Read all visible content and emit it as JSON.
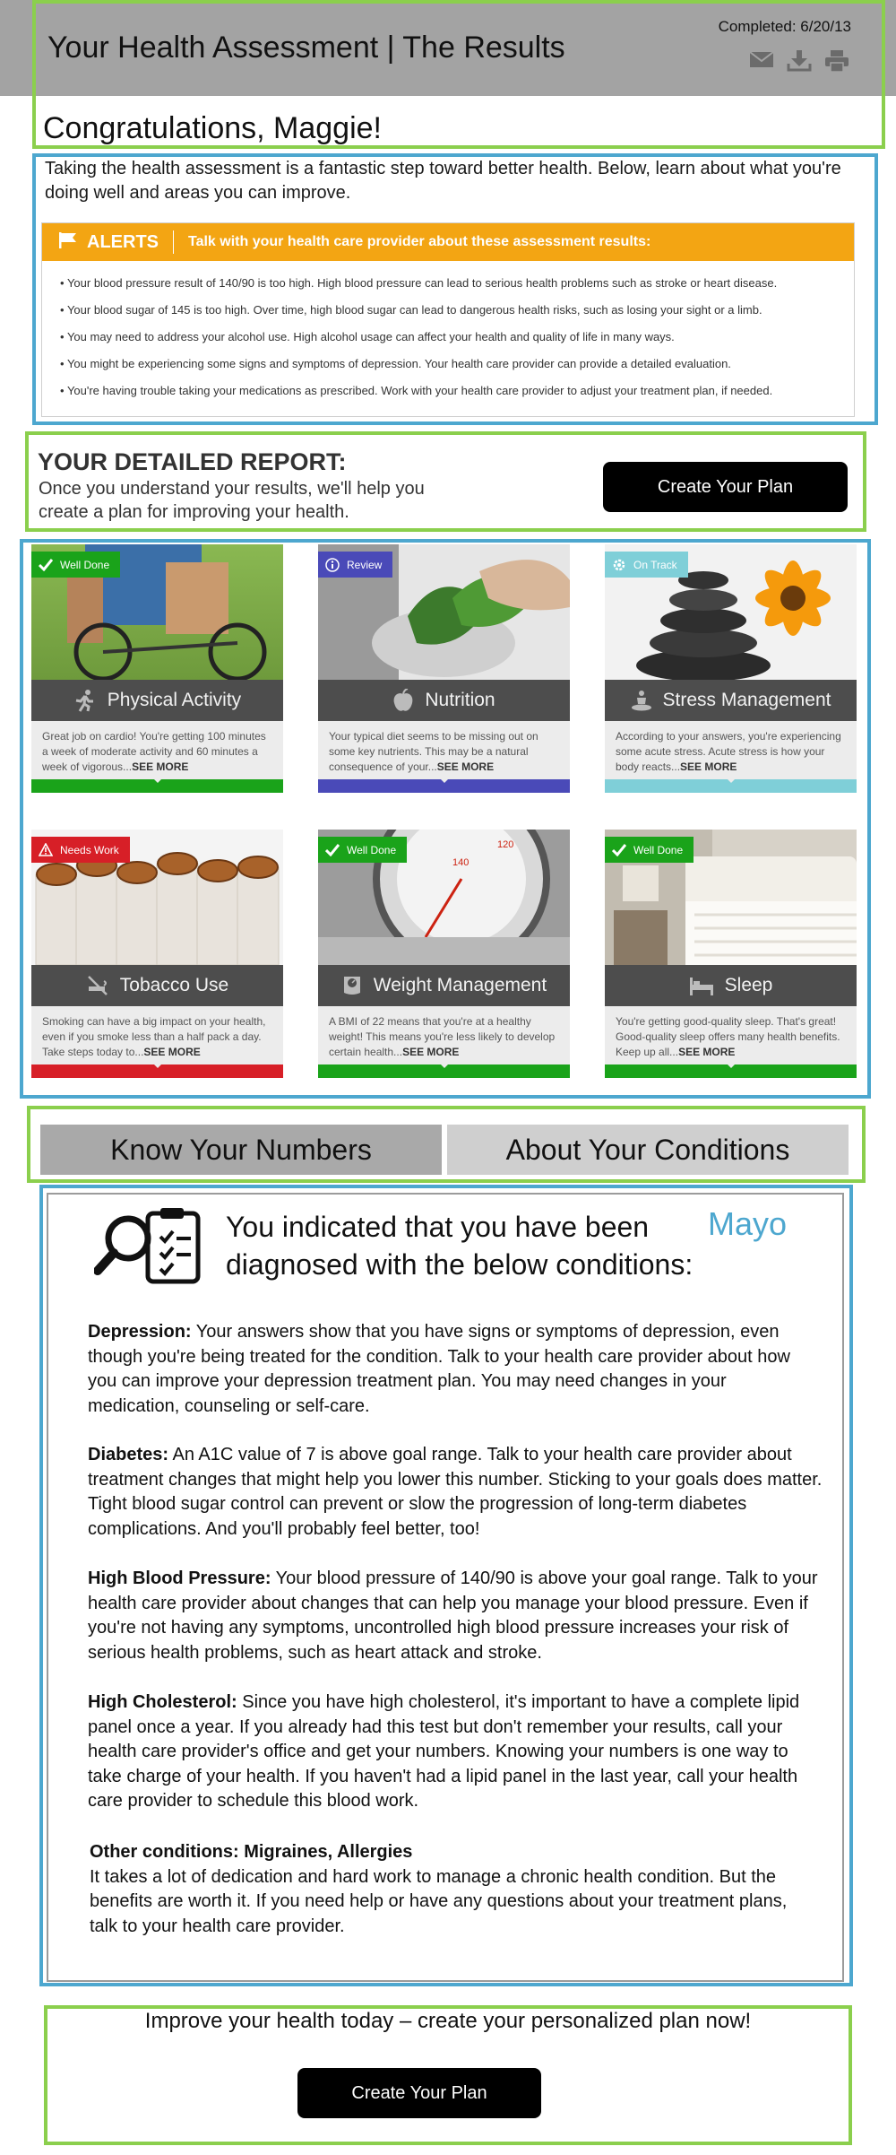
{
  "header": {
    "completed": "Completed: 6/20/13",
    "title": "Your Health Assessment | The Results",
    "icons": [
      "mail-icon",
      "download-icon",
      "print-icon"
    ]
  },
  "greeting": "Congratulations, Maggie!",
  "intro": "Taking the health assessment is a fantastic step toward better health. Below, learn about what you're doing well and areas you can improve.",
  "alerts": {
    "title": "ALERTS",
    "subtitle": "Talk with your health care provider about these assessment results:",
    "items": [
      "Your blood pressure result of 140/90 is too high. High blood pressure can lead to serious health problems such as stroke or heart disease.",
      "Your blood sugar of 145 is too high. Over time, high blood sugar can lead to dangerous health risks, such as losing your sight or a limb.",
      "You may need to address your alcohol use. High alcohol usage can affect your health and quality of life in many ways.",
      "You might be experiencing some signs and symptoms of depression. Your health care provider can provide a detailed evaluation.",
      "You're having trouble taking your medications as prescribed. Work with your health care provider to adjust your treatment plan, if needed."
    ],
    "color": "#f3a513"
  },
  "report": {
    "title": "YOUR DETAILED REPORT:",
    "subtitle": "Once you understand your results, we'll help you create a plan for improving your health.",
    "button": "Create Your Plan"
  },
  "cards": [
    {
      "badge": "Well Done",
      "badge_color": "#1aa31a",
      "label": "Physical Activity",
      "icon": "runner-icon",
      "text": "Great job on cardio! You're getting 100 minutes a week of moderate activity and 60 minutes a week of vigorous...",
      "more": "SEE MORE",
      "bar_color": "#1aa31a"
    },
    {
      "badge": "Review",
      "badge_color": "#4a4ab8",
      "label": "Nutrition",
      "icon": "apple-icon",
      "text": "Your typical diet seems to be missing out on some key nutrients. This may be a natural consequence of your...",
      "more": "SEE MORE",
      "bar_color": "#4a4ab8"
    },
    {
      "badge": "On Track",
      "badge_color": "#7fcfd8",
      "label": "Stress Management",
      "icon": "meditation-icon",
      "text": "According to your answers, you're experiencing some acute stress. Acute stress is how your body reacts...",
      "more": "SEE MORE",
      "bar_color": "#7fcfd8"
    },
    {
      "badge": "Needs Work",
      "badge_color": "#d71f27",
      "label": "Tobacco Use",
      "icon": "no-smoking-icon",
      "text": "Smoking can have a big impact on your health, even if you smoke less than a half pack a day. Take steps today to...",
      "more": "SEE MORE",
      "bar_color": "#d71f27"
    },
    {
      "badge": "Well Done",
      "badge_color": "#1aa31a",
      "label": "Weight Management",
      "icon": "scale-icon",
      "text": "A BMI of 22 means that you're at a healthy weight! This means you're less likely to develop certain health...",
      "more": "SEE MORE",
      "bar_color": "#1aa31a"
    },
    {
      "badge": "Well Done",
      "badge_color": "#1aa31a",
      "label": "Sleep",
      "icon": "bed-icon",
      "text": "You're getting good-quality sleep. That's great! Good-quality sleep offers many health benefits. Keep up all...",
      "more": "SEE MORE",
      "bar_color": "#1aa31a"
    }
  ],
  "tabs": {
    "numbers": "Know Your Numbers",
    "conditions": "About Your Conditions"
  },
  "conditions": {
    "icon": "checklist-magnifier-icon",
    "title": "You indicated that you have been diagnosed with the below conditions:",
    "note": "Mayo",
    "depression": {
      "head": "Depression:",
      "body": " Your answers show that you have signs or symptoms of depression, even though you're being treated for the condition. Talk to your health care provider about how you can improve your depression treatment plan. You may need changes in your medication, counseling or self-care."
    },
    "diabetes": {
      "head": "Diabetes:",
      "body": " An A1C value of 7 is above goal range. Talk to your health care provider about treatment changes that might help you lower this number. Sticking to your goals does matter. Tight blood sugar control can prevent or slow the progression of long-term diabetes complications. And you'll probably feel better, too!"
    },
    "hbp": {
      "head": "High Blood Pressure:",
      "body": " Your blood pressure of 140/90 is above your goal range. Talk to your health care provider about changes that can help you manage your blood pressure. Even if you're not having any symptoms, uncontrolled high blood pressure increases your risk of serious health problems, such as heart attack and stroke."
    },
    "cholesterol": {
      "head": "High Cholesterol:",
      "body": " Since you have high cholesterol, it's important to have a complete lipid panel once a year. If you already had this test but don't remember your results, call your health care provider's office and get your numbers. Knowing your numbers is one way to take charge of your health.  If you haven't had a lipid panel in the last year, call your health care provider to schedule this blood work."
    },
    "other": {
      "head": "Other conditions: Migraines, Allergies",
      "body": "It takes a lot of dedication and hard work to manage a chronic health condition. But the benefits are worth it. If you need help or have any questions about your treatment plans, talk to your health care provider."
    }
  },
  "cta": {
    "text": "Improve your health today – create your personalized plan now!",
    "button": "Create Your Plan"
  }
}
